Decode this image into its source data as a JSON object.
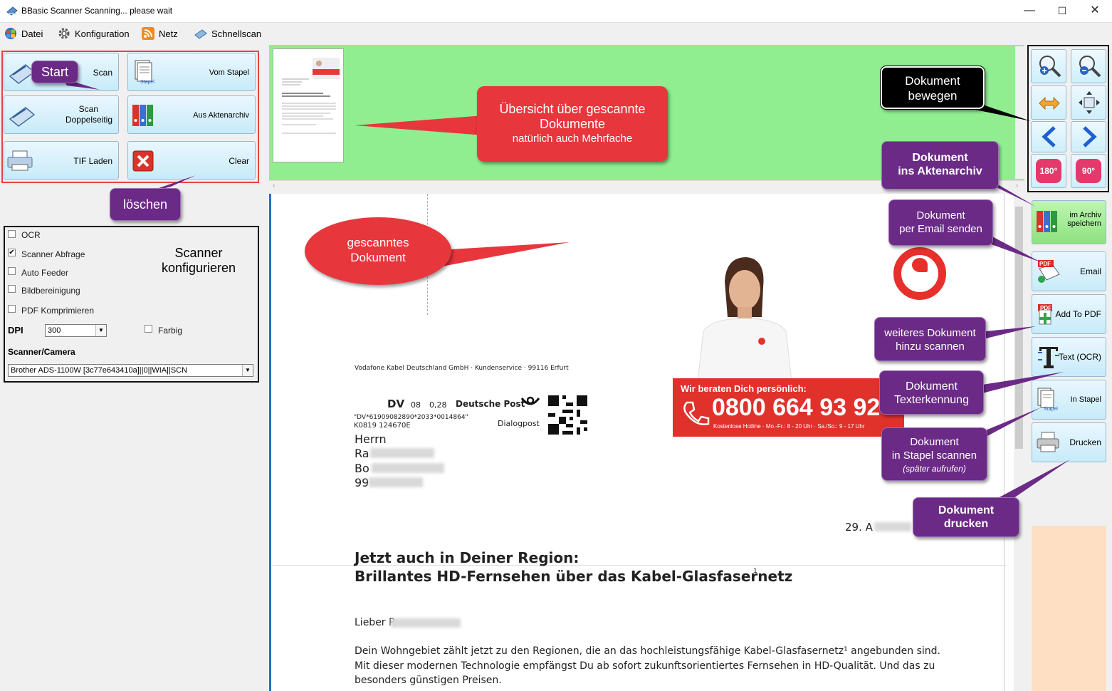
{
  "window": {
    "title": "BBasic Scanner Scanning... please wait",
    "controls": {
      "minimize": "—",
      "maximize": "☐",
      "close": "✕"
    }
  },
  "menu": [
    {
      "label": "Datei",
      "icon": "windows-orb-icon"
    },
    {
      "label": "Konfiguration",
      "icon": "gear-icon"
    },
    {
      "label": "Netz",
      "icon": "rss-icon"
    },
    {
      "label": "Schnellscan",
      "icon": "scanner-icon"
    }
  ],
  "left": {
    "buttons": {
      "scan": "Scan",
      "vom_stapel": "Vom Stapel",
      "stapel_icon_text": "Stapel",
      "scan_doppelseitig_1": "Scan",
      "scan_doppelseitig_2": "Doppelseitig",
      "aus_aktenarchiv": "Aus Aktenarchiv",
      "tif_laden": "TIF Laden",
      "clear": "Clear"
    },
    "options": {
      "ocr": {
        "label": "OCR",
        "checked": false
      },
      "scanner_abfrage": {
        "label": "Scanner Abfrage",
        "checked": true
      },
      "auto_feeder": {
        "label": "Auto Feeder",
        "checked": false
      },
      "bildbereinigung": {
        "label": "Bildbereinigung",
        "checked": false
      },
      "pdf_komprimieren": {
        "label": "PDF Komprimieren",
        "checked": false
      },
      "farbig": {
        "label": "Farbig",
        "checked": false
      }
    },
    "dpi_label": "DPI",
    "dpi_value": "300",
    "scanner_label": "Scanner/Camera",
    "scanner_value": "Brother ADS-1100W [3c77e643410a]||0||WIA||SCN"
  },
  "callouts": {
    "start": "Start",
    "loeschen": "löschen",
    "scanner_konfig_1": "Scanner",
    "scanner_konfig_2": "konfigurieren",
    "uebersicht_1": "Übersicht über gescannte",
    "uebersicht_2": "Dokumente",
    "uebersicht_3": "natürlich auch Mehrfache",
    "gescanntes_1": "gescanntes",
    "gescanntes_2": "Dokument",
    "bewegen_1": "Dokument",
    "bewegen_2": "bewegen",
    "aktenarchiv_1": "Dokument",
    "aktenarchiv_2": "ins Aktenarchiv",
    "email_1": "Dokument",
    "email_2": "per  Email senden",
    "weiteres_1": "weiteres Dokument",
    "weiteres_2": "hinzu scannen",
    "ocr_1": "Dokument",
    "ocr_2": "Texterkennung",
    "stapel_1": "Dokument",
    "stapel_2": "in Stapel scannen",
    "stapel_3": "(später aufrufen)",
    "drucken_1": "Dokument",
    "drucken_2": "drucken"
  },
  "right": {
    "tools": [
      "zoom-in-icon",
      "zoom-out-icon",
      "fit-width-icon",
      "fit-page-icon",
      "previous-icon",
      "next-icon",
      "rotate-180-icon",
      "rotate-90-icon"
    ],
    "rotate_180": "180°",
    "rotate_90": "90°",
    "actions": {
      "archiv_1": "im Archiv",
      "archiv_2": "speichern",
      "email": "Email",
      "add_to_pdf": "Add To PDF",
      "ocr": "Text (OCR)",
      "in_stapel": "In Stapel",
      "drucken": "Drucken",
      "pdf_icon_text": "PDF",
      "stapel_icon_text": "Stapel"
    }
  },
  "document": {
    "sender": "Vodafone Kabel Deutschland GmbH · Kundenservice · 99116 Erfurt",
    "dv": "DV",
    "dv_num": "08",
    "dv_price": "0,28",
    "deutsche_post": "Deutsche Post",
    "dialogpost": "Dialogpost",
    "code_line": "\"DV*61909082890*2033*0014864\"",
    "k_line": "K0819  124670E",
    "salutation": "Herrn",
    "name_part": "Ra",
    "street_part": "Bo",
    "city_part": "99",
    "date_part": "29. A",
    "promo_head": "Wir beraten Dich persönlich:",
    "promo_number": "0800 664 93 92",
    "promo_sub": "Kostenlose Hotline · Mo.-Fr.: 8 - 20 Uhr · Sa./So.: 9 - 17 Uhr",
    "headline_1": "Jetzt auch in Deiner Region:",
    "headline_2": "Brillantes HD-Fernsehen über das Kabel-Glasfasernetz",
    "headline_sup": "1",
    "greeting": "Lieber R",
    "body_1": "Dein Wohngebiet zählt jetzt zu den Regionen, die an das hochleistungsfähige Kabel-Glasfasernetz¹ angebunden sind.",
    "body_2": "Mit dieser modernen Technologie empfängst Du ab sofort zukunftsorientiertes Fernsehen in HD-Qualität. Und das zu",
    "body_3": "besonders günstigen Preisen."
  }
}
